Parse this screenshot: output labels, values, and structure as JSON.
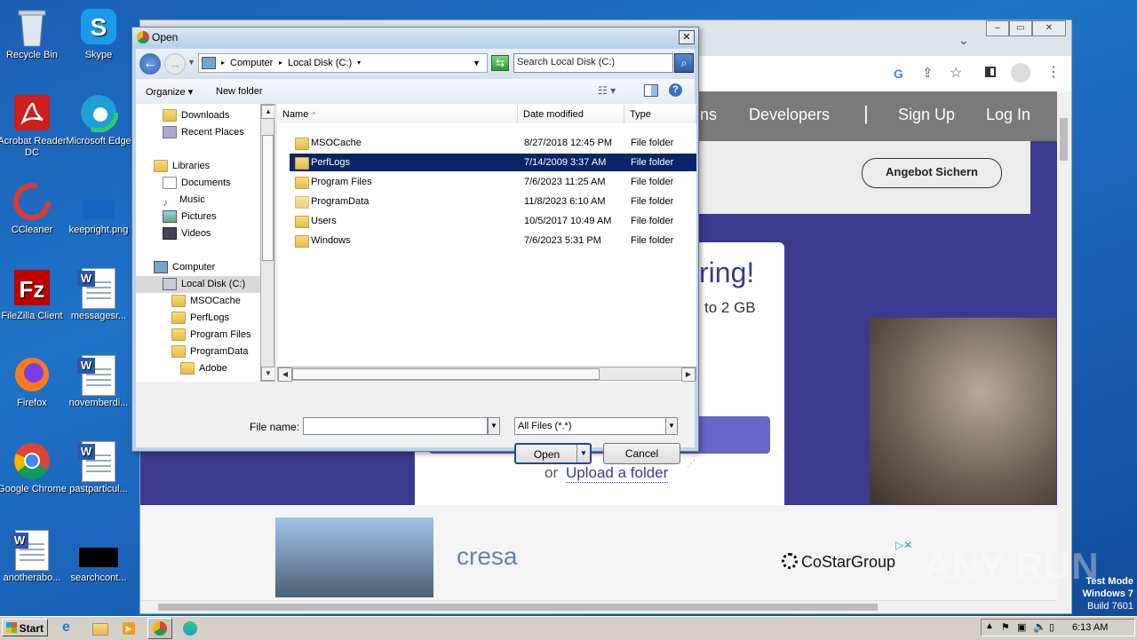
{
  "desktop": {
    "icons": [
      {
        "label": "Recycle Bin"
      },
      {
        "label": "Skype"
      },
      {
        "label": "Acrobat Reader DC"
      },
      {
        "label": "Microsoft Edge"
      },
      {
        "label": "CCleaner"
      },
      {
        "label": "keepright.png"
      },
      {
        "label": "FileZilla Client"
      },
      {
        "label": "messagesr..."
      },
      {
        "label": "Firefox"
      },
      {
        "label": "novemberdi..."
      },
      {
        "label": "Google Chrome"
      },
      {
        "label": "pastparticul..."
      },
      {
        "label": "anotherabo..."
      },
      {
        "label": "searchcont..."
      }
    ],
    "watermark": {
      "brand": "ANY RUN",
      "line1": "Test Mode",
      "line2": "Windows 7",
      "line3": "Build 7601"
    }
  },
  "browser": {
    "nav": {
      "item1": "ns",
      "item2": "Developers",
      "separator": "|",
      "item3": "Sign Up",
      "item4": "Log In"
    },
    "cta_button": "Angebot Sichern",
    "card": {
      "heading": "ring!",
      "subtext": "to 2 GB",
      "or": "or",
      "link": "Upload a folder"
    },
    "ad": {
      "brand1": "cresa",
      "brand2": "CoStarGroup"
    }
  },
  "dialog": {
    "title": "Open",
    "path": {
      "crumb1": "Computer",
      "crumb2": "Local Disk (C:)"
    },
    "search_placeholder": "Search Local Disk (C:)",
    "toolbar": {
      "organize": "Organize",
      "new_folder": "New folder"
    },
    "tree": [
      "Downloads",
      "Recent Places",
      "Libraries",
      "Documents",
      "Music",
      "Pictures",
      "Videos",
      "Computer",
      "Local Disk (C:)",
      "MSOCache",
      "PerfLogs",
      "Program Files",
      "ProgramData",
      "Adobe"
    ],
    "columns": {
      "name": "Name",
      "date": "Date modified",
      "type": "Type"
    },
    "files": [
      {
        "name": "MSOCache",
        "date": "8/27/2018 12:45 PM",
        "type": "File folder"
      },
      {
        "name": "PerfLogs",
        "date": "7/14/2009 3:37 AM",
        "type": "File folder"
      },
      {
        "name": "Program Files",
        "date": "7/6/2023 11:25 AM",
        "type": "File folder"
      },
      {
        "name": "ProgramData",
        "date": "11/8/2023 6:10 AM",
        "type": "File folder"
      },
      {
        "name": "Users",
        "date": "10/5/2017 10:49 AM",
        "type": "File folder"
      },
      {
        "name": "Windows",
        "date": "7/6/2023 5:31 PM",
        "type": "File folder"
      }
    ],
    "filename_label": "File name:",
    "filename_value": "",
    "filter": "All Files (*.*)",
    "open_button": "Open",
    "cancel_button": "Cancel"
  },
  "taskbar": {
    "start": "Start",
    "clock": "6:13 AM"
  },
  "colors": {
    "selection": "#0a246a",
    "hero": "#3c3a8f",
    "desktop": "#1f73c9"
  }
}
